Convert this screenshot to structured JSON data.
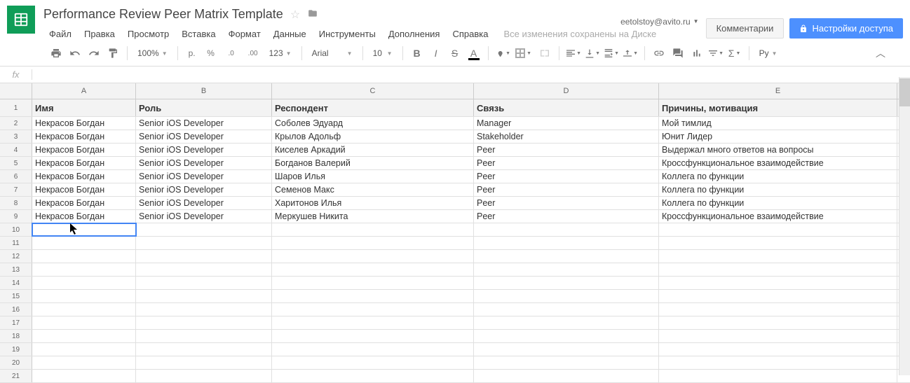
{
  "account_email": "eetolstoy@avito.ru",
  "doc_title": "Performance Review Peer Matrix Template",
  "menus": [
    "Файл",
    "Правка",
    "Просмотр",
    "Вставка",
    "Формат",
    "Данные",
    "Инструменты",
    "Дополнения",
    "Справка"
  ],
  "save_status": "Все изменения сохранены на Диске",
  "btn_comments": "Комментарии",
  "btn_share": "Настройки доступа",
  "toolbar": {
    "zoom": "100%",
    "currency": "р.",
    "percent": "%",
    "dec_dec": ".0",
    "dec_inc": ".00",
    "numfmt": "123",
    "font": "Arial",
    "size": "10",
    "script_lang": "Ру"
  },
  "columns": [
    "A",
    "B",
    "C",
    "D",
    "E"
  ],
  "header_row": [
    "Имя",
    "Роль",
    "Респондент",
    "Связь",
    "Причины, мотивация"
  ],
  "rows": [
    [
      "Некрасов Богдан",
      "Senior iOS Developer",
      "Соболев Эдуард",
      "Manager",
      "Мой тимлид"
    ],
    [
      "Некрасов Богдан",
      "Senior iOS Developer",
      "Крылов Адольф",
      "Stakeholder",
      "Юнит Лидер"
    ],
    [
      "Некрасов Богдан",
      "Senior iOS Developer",
      "Киселев Аркадий",
      "Peer",
      "Выдержал много ответов на вопросы"
    ],
    [
      "Некрасов Богдан",
      "Senior iOS Developer",
      "Богданов Валерий",
      "Peer",
      "Кроссфункциональное взаимодействие"
    ],
    [
      "Некрасов Богдан",
      "Senior iOS Developer",
      "Шаров Илья",
      "Peer",
      "Коллега по функции"
    ],
    [
      "Некрасов Богдан",
      "Senior iOS Developer",
      "Семенов Макс",
      "Peer",
      "Коллега по функции"
    ],
    [
      "Некрасов Богдан",
      "Senior iOS Developer",
      "Харитонов Илья",
      "Peer",
      "Коллега по функции"
    ],
    [
      "Некрасов Богдан",
      "Senior iOS Developer",
      "Меркушев Никита",
      "Peer",
      "Кроссфункциональное взаимодействие"
    ]
  ],
  "row_numbers": [
    "1",
    "2",
    "3",
    "4",
    "5",
    "6",
    "7",
    "8",
    "9",
    "10",
    "11",
    "12",
    "13",
    "14",
    "15",
    "16",
    "17",
    "18",
    "19",
    "20",
    "21"
  ],
  "selected_row": 10,
  "fx_label": "fx"
}
